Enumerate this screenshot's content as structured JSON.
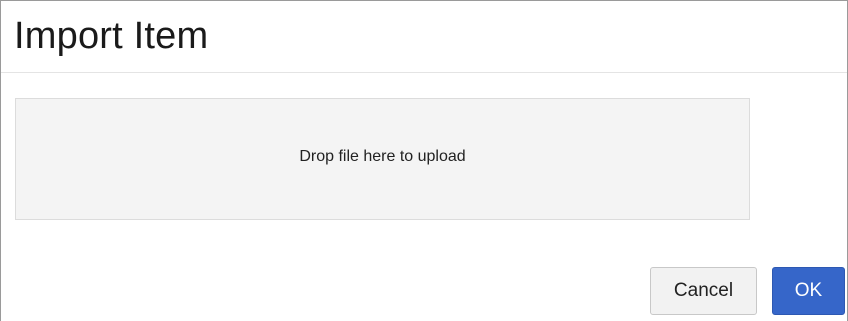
{
  "dialog": {
    "title": "Import Item",
    "drop_zone": {
      "text": "Drop file here to upload"
    },
    "buttons": {
      "cancel_label": "Cancel",
      "ok_label": "OK"
    }
  },
  "colors": {
    "primary_button": "#3666c9",
    "secondary_button": "#f2f2f2",
    "drop_zone_background": "#f4f4f4"
  }
}
